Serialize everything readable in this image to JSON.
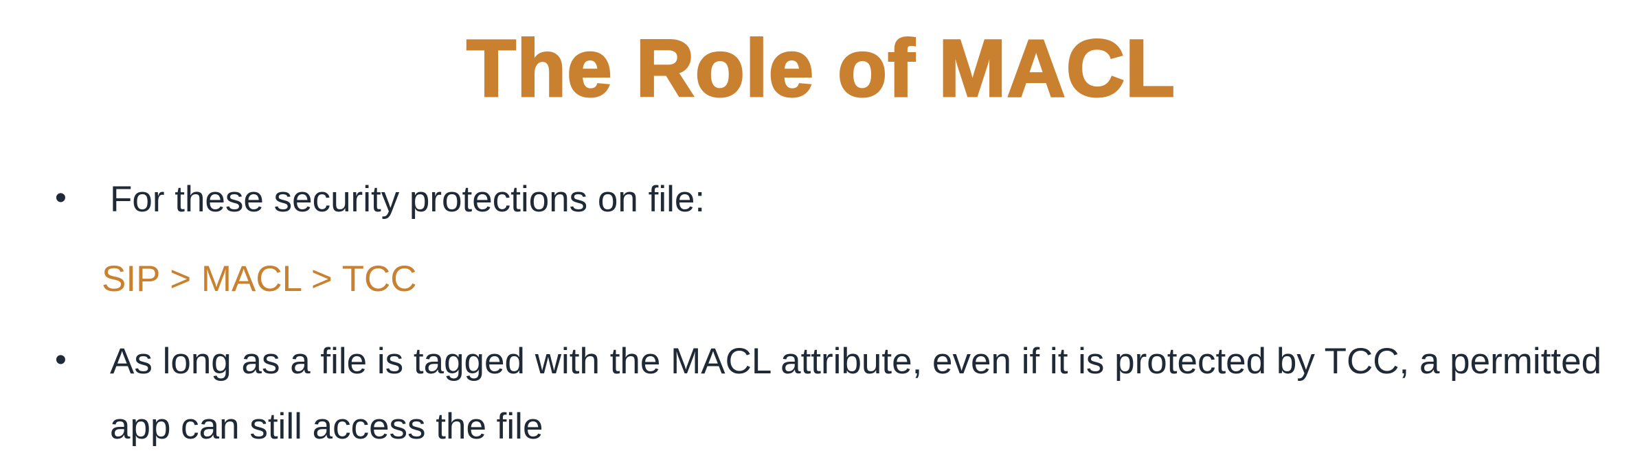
{
  "slide": {
    "title": "The Role of MACL",
    "bullets": [
      {
        "symbol": "•",
        "text": "For these security protections on file:"
      },
      {
        "symbol": "•",
        "text": "As long as a file is tagged with the MACL attribute, even if it is protected by TCC, a permitted app can still access the file"
      }
    ],
    "precedence_line": "SIP > MACL > TCC"
  },
  "colors": {
    "accent": "#c98130",
    "body_text": "#1f2a36",
    "background": "#ffffff"
  }
}
